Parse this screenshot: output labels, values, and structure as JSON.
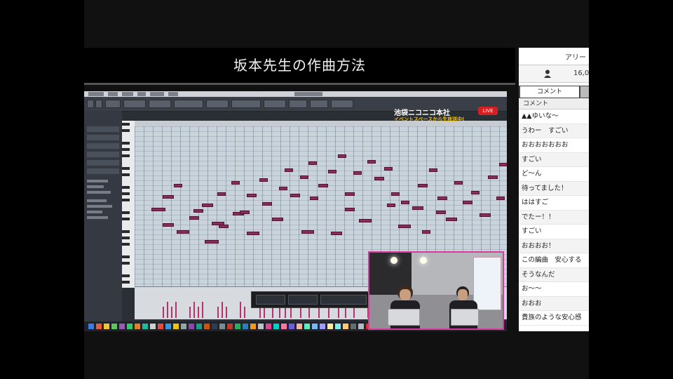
{
  "stream": {
    "title": "坂本先生の作曲方法"
  },
  "overlay": {
    "channel_logo": "池袋ニコニコ本社",
    "live_badge": "LIVE",
    "subtitle": "イベントスペースから生放送中!"
  },
  "comment_panel": {
    "header_text": "アリー",
    "viewer_count": "16,0",
    "tab_label": "コメント",
    "column_label": "コメント",
    "comments": [
      "▲▲ゆいな～",
      "うわー　すごい",
      "おおおおおおお",
      "すごい",
      "ど～ん",
      "待ってました！",
      "ははすご",
      "でたー！！",
      "すごい",
      "おおおお！",
      "この編曲　安心する",
      "そうなんだ",
      "お～～",
      "おおお",
      "貴族のような安心感"
    ]
  },
  "colors": {
    "note": "#8c2a5a",
    "velocity": "#b3336f",
    "webcam_border": "#d93a9b",
    "live_red": "#d42020",
    "subtitle_yellow": "#f3c200"
  },
  "icons": [
    "user-icon",
    "live-badge",
    "app-dock-icons"
  ]
}
